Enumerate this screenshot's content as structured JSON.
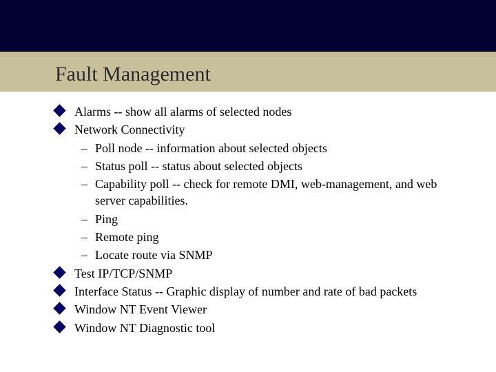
{
  "title": "Fault Management",
  "bullets": [
    {
      "text": "Alarms -- show all alarms of selected nodes"
    },
    {
      "text": "Network Connectivity",
      "sub": [
        "Poll node -- information about selected objects",
        "Status poll -- status about selected objects",
        "Capability poll -- check for remote DMI, web-management, and web server capabilities.",
        "Ping",
        "Remote ping",
        "Locate route via SNMP"
      ]
    },
    {
      "text": "Test IP/TCP/SNMP"
    },
    {
      "text": "Interface Status -- Graphic display of number and rate of bad packets"
    },
    {
      "text": "Window NT Event Viewer"
    },
    {
      "text": "Window NT Diagnostic tool"
    }
  ]
}
